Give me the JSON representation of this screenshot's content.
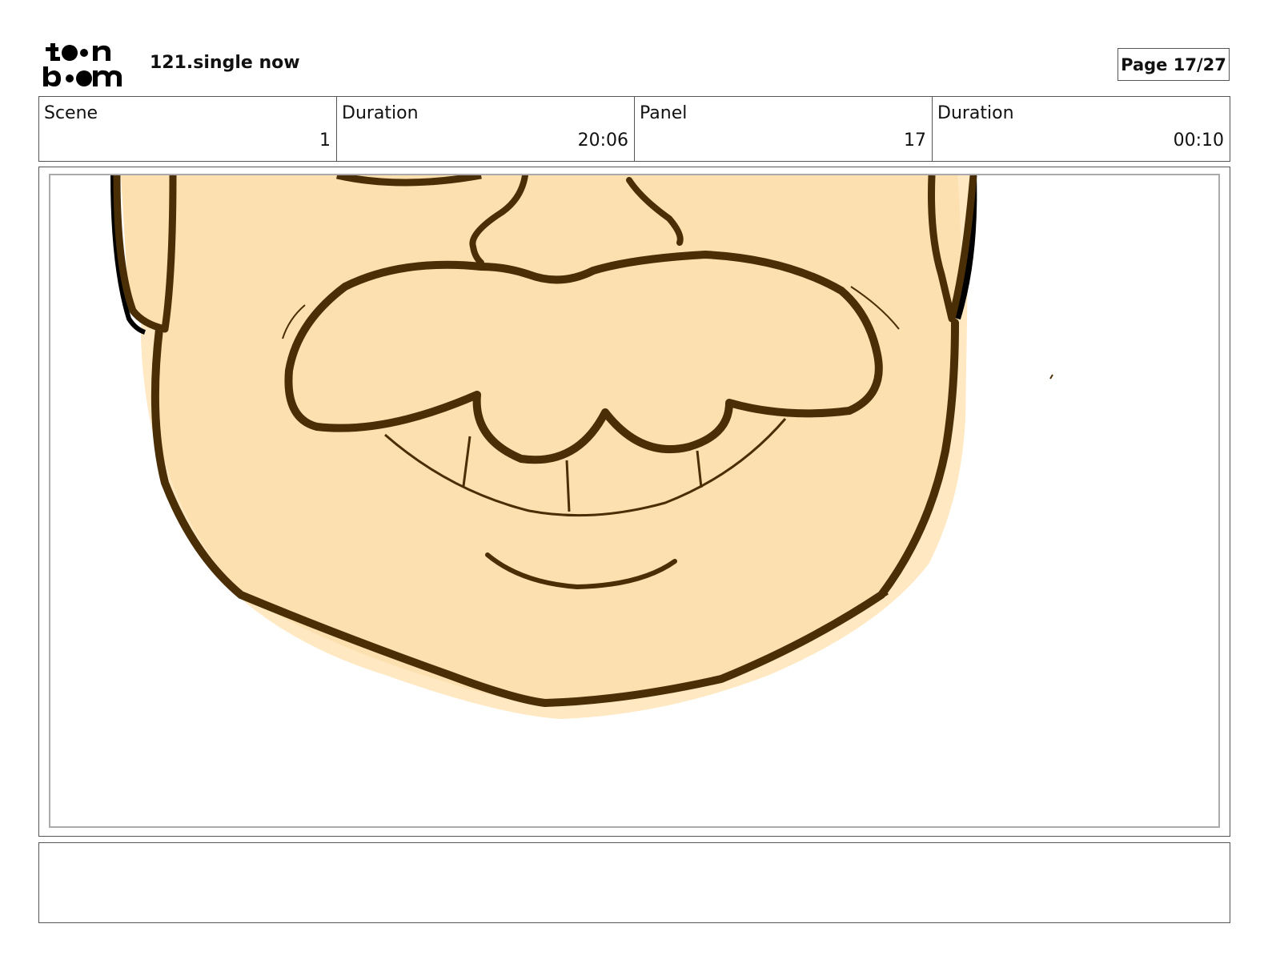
{
  "header": {
    "logo_text": "toonboom",
    "title": "121.single now",
    "page_label": "Page 17/27"
  },
  "info": [
    {
      "label": "Scene",
      "value": "1"
    },
    {
      "label": "Duration",
      "value": "20:06"
    },
    {
      "label": "Panel",
      "value": "17"
    },
    {
      "label": "Duration",
      "value": "00:10"
    }
  ],
  "panel": {
    "image_description_icon": "cartoon-face-closeup",
    "colors": {
      "skin": "#FDE0B0",
      "skin_shadow": "#FFE8C2",
      "outline": "#4A2E05"
    }
  },
  "notes": {
    "text": ""
  }
}
